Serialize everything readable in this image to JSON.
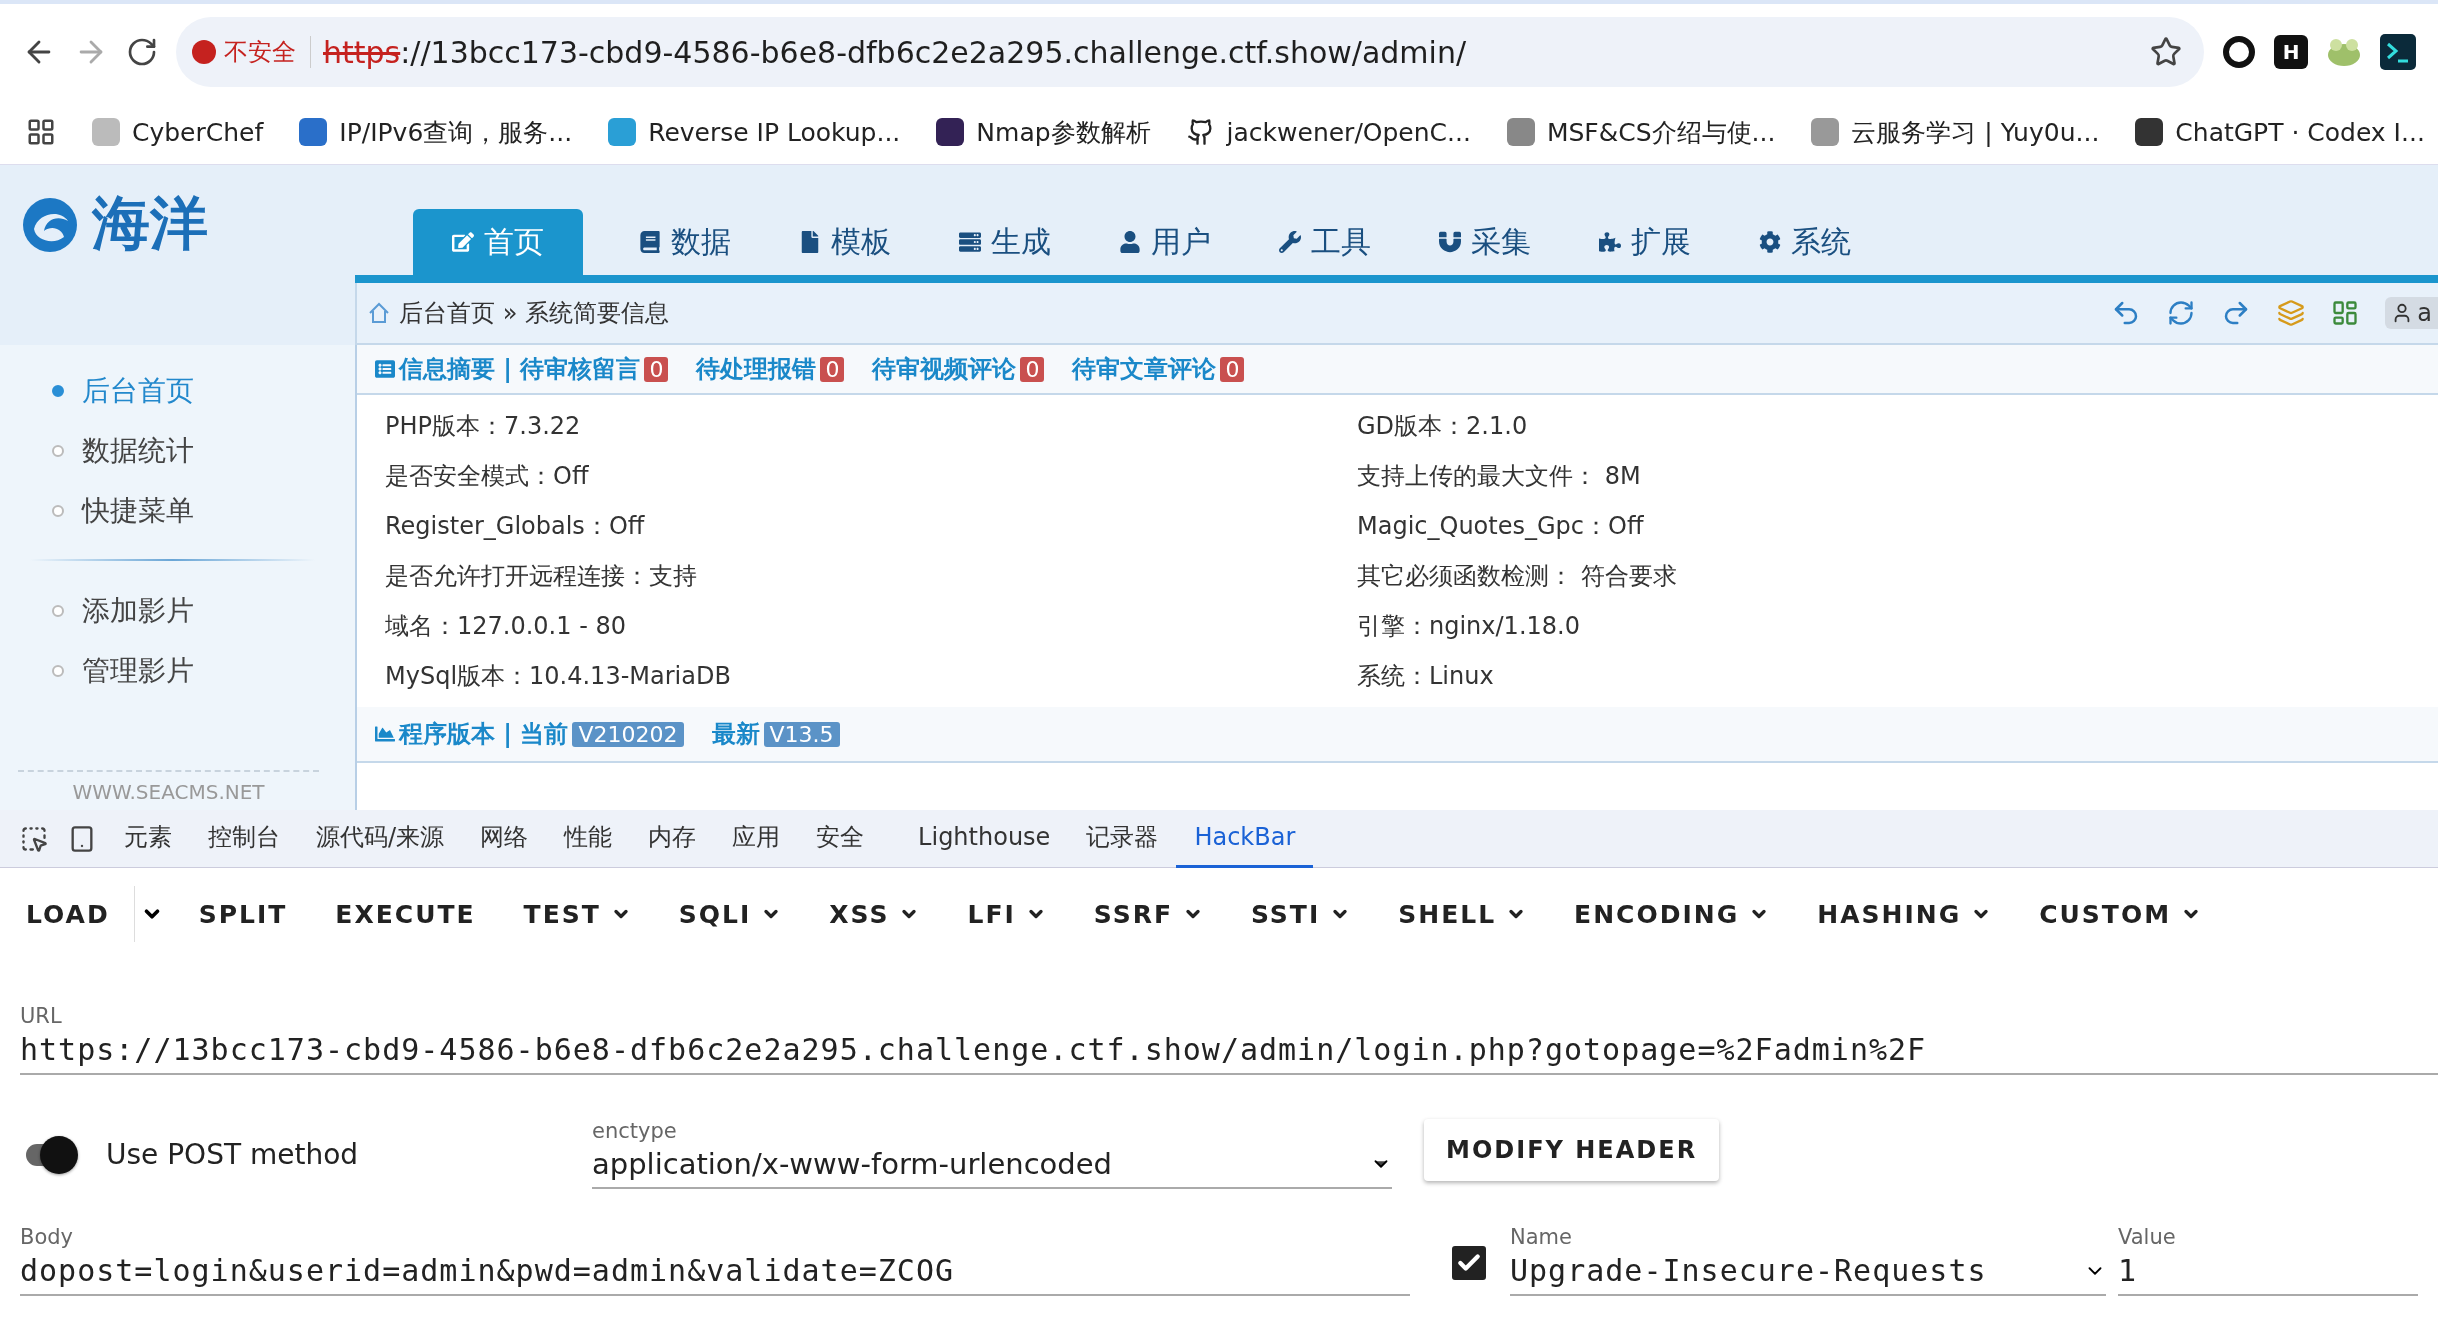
{
  "browser": {
    "security_label": "不安全",
    "url_scheme": "https",
    "url_rest": "://13bcc173-cbd9-4586-b6e8-dfb6c2e2a295.challenge.ctf.show/admin/",
    "extension_letter": "H",
    "bookmarks": [
      "CyberChef",
      "IP/IPv6查询，服务...",
      "Reverse IP Lookup...",
      "Nmap参数解析",
      "jackwener/OpenC...",
      "MSF&CS介绍与使...",
      "云服务学习 | Yuy0u...",
      "ChatGPT · Codex I..."
    ]
  },
  "site": {
    "logo_text": "海洋",
    "nav": [
      {
        "label": "首页",
        "selected": true
      },
      {
        "label": "数据",
        "selected": false
      },
      {
        "label": "模板",
        "selected": false
      },
      {
        "label": "生成",
        "selected": false
      },
      {
        "label": "用户",
        "selected": false
      },
      {
        "label": "工具",
        "selected": false
      },
      {
        "label": "采集",
        "selected": false
      },
      {
        "label": "扩展",
        "selected": false
      },
      {
        "label": "系统",
        "selected": false
      }
    ],
    "breadcrumb": [
      "后台首页",
      "系统简要信息"
    ],
    "breadcrumb_separator": "»",
    "user_badge": "a"
  },
  "sidebar": {
    "groups": [
      [
        {
          "label": "后台首页",
          "selected": true
        },
        {
          "label": "数据统计",
          "selected": false
        },
        {
          "label": "快捷菜单",
          "selected": false
        }
      ],
      [
        {
          "label": "添加影片",
          "selected": false
        },
        {
          "label": "管理影片",
          "selected": false
        }
      ]
    ],
    "footer": "WWW.SEACMS.NET"
  },
  "summary": {
    "links": [
      {
        "label": "信息摘要 | 待审核留言",
        "count": "0"
      },
      {
        "label": "待处理报错",
        "count": "0"
      },
      {
        "label": "待审视频评论",
        "count": "0"
      },
      {
        "label": "待审文章评论",
        "count": "0"
      }
    ],
    "rows": [
      [
        "PHP版本：7.3.22",
        "GD版本：2.1.0"
      ],
      [
        "是否安全模式：Off",
        "支持上传的最大文件： 8M"
      ],
      [
        "Register_Globals：Off",
        "Magic_Quotes_Gpc：Off"
      ],
      [
        "是否允许打开远程连接：支持",
        "其它必须函数检测： 符合要求"
      ],
      [
        "域名：127.0.0.1 - 80",
        "引擎：nginx/1.18.0"
      ],
      [
        "MySql版本：10.4.13-MariaDB",
        "系统：Linux"
      ]
    ],
    "versions": [
      {
        "label": "程序版本 | 当前",
        "badge": "V210202"
      },
      {
        "label": "最新",
        "badge": "V13.5"
      }
    ]
  },
  "devtools": {
    "tabs": [
      {
        "label": "元素",
        "selected": false
      },
      {
        "label": "控制台",
        "selected": false
      },
      {
        "label": "源代码/来源",
        "selected": false
      },
      {
        "label": "网络",
        "selected": false
      },
      {
        "label": "性能",
        "selected": false
      },
      {
        "label": "内存",
        "selected": false
      },
      {
        "label": "应用",
        "selected": false
      },
      {
        "label": "安全",
        "selected": false
      },
      {
        "label": "Lighthouse",
        "selected": false
      },
      {
        "label": "记录器",
        "selected": false
      },
      {
        "label": "HackBar",
        "selected": true
      }
    ]
  },
  "hackbar": {
    "buttons": [
      {
        "label": "LOAD",
        "kind": "split"
      },
      {
        "label": "SPLIT",
        "kind": "plain"
      },
      {
        "label": "EXECUTE",
        "kind": "plain"
      },
      {
        "label": "TEST",
        "kind": "menu"
      },
      {
        "label": "SQLI",
        "kind": "menu"
      },
      {
        "label": "XSS",
        "kind": "menu"
      },
      {
        "label": "LFI",
        "kind": "menu"
      },
      {
        "label": "SSRF",
        "kind": "menu"
      },
      {
        "label": "SSTI",
        "kind": "menu"
      },
      {
        "label": "SHELL",
        "kind": "menu"
      },
      {
        "label": "ENCODING",
        "kind": "menu"
      },
      {
        "label": "HASHING",
        "kind": "menu"
      },
      {
        "label": "CUSTOM",
        "kind": "menu"
      }
    ],
    "url": {
      "label": "URL",
      "value": "https://13bcc173-cbd9-4586-b6e8-dfb6c2e2a295.challenge.ctf.show/admin/login.php?gotopage=%2Fadmin%2F"
    },
    "post": {
      "label": "Use POST method",
      "on": true
    },
    "enctype": {
      "label": "enctype",
      "value": "application/x-www-form-urlencoded"
    },
    "modify_header": "MODIFY HEADER",
    "body": {
      "label": "Body",
      "value": "dopost=login&userid=admin&pwd=admin&validate=ZCOG"
    },
    "header": {
      "checked": true,
      "name_label": "Name",
      "name": "Upgrade-Insecure-Requests",
      "value_label": "Value",
      "value": "1"
    }
  }
}
